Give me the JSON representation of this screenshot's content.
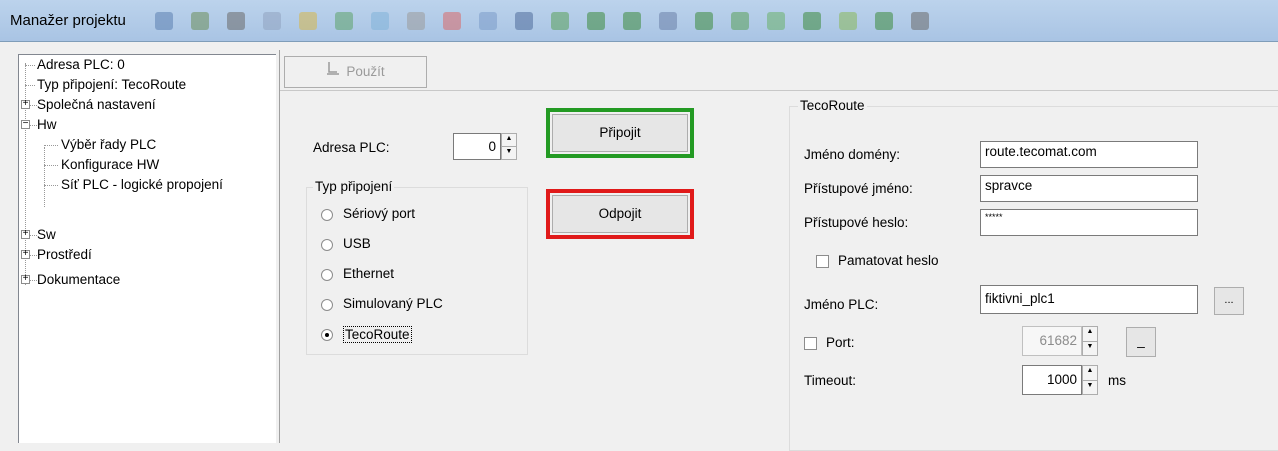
{
  "window": {
    "title": "Manažer projektu"
  },
  "toolbar_icon_colors": [
    "#5b7fb0",
    "#6b8e5a",
    "#6a6a6a",
    "#8fa2c0",
    "#d6b64a",
    "#5ca36a",
    "#7fb2d8",
    "#9a9a9a",
    "#d86a6a",
    "#7a9ac8",
    "#4e6b9a",
    "#5aa05a",
    "#3d8b3d",
    "#3d8b3d",
    "#6a7fa8",
    "#3d8b3d",
    "#5aa05a",
    "#6ab06a",
    "#3d8b3d",
    "#88b85a",
    "#3d8b3d",
    "#6a6a6a"
  ],
  "tree": {
    "items": [
      {
        "label": "Adresa PLC: 0",
        "expander": ""
      },
      {
        "label": "Typ připojení: TecoRoute",
        "expander": ""
      },
      {
        "label": "Společná nastavení",
        "expander": "+"
      },
      {
        "label": "Hw",
        "expander": "−"
      },
      {
        "label": "Výběr řady PLC",
        "expander": ""
      },
      {
        "label": "Konfigurace HW",
        "expander": ""
      },
      {
        "label": "Síť PLC - logické propojení",
        "expander": ""
      },
      {
        "label": "Sw",
        "expander": "+"
      },
      {
        "label": "Prostředí",
        "expander": "+"
      },
      {
        "label": "Dokumentace",
        "expander": "+"
      }
    ]
  },
  "apply_button": {
    "label": "Použít"
  },
  "plc_address": {
    "label": "Adresa PLC:",
    "value": "0"
  },
  "connect_button": {
    "label": "Připojit"
  },
  "disconnect_button": {
    "label": "Odpojit"
  },
  "connection_type": {
    "legend": "Typ připojení",
    "options": [
      "Sériový port",
      "USB",
      "Ethernet",
      "Simulovaný PLC",
      "TecoRoute"
    ],
    "selected": "TecoRoute"
  },
  "tecoroute": {
    "legend": "TecoRoute",
    "domain_label": "Jméno domény:",
    "domain_value": "route.tecomat.com",
    "login_label": "Přístupové jméno:",
    "login_value": "spravce",
    "password_label": "Přístupové heslo:",
    "password_value": "*****",
    "remember_label": "Pamatovat heslo",
    "plc_name_label": "Jméno PLC:",
    "plc_name_value": "fiktivni_plc1",
    "browse_label": "...",
    "port_label": "Port:",
    "port_value": "61682",
    "port_reset_label": "_",
    "timeout_label": "Timeout:",
    "timeout_value": "1000",
    "timeout_unit": "ms"
  },
  "colors": {
    "connect_outline": "#239a23",
    "disconnect_outline": "#e01a1a"
  }
}
